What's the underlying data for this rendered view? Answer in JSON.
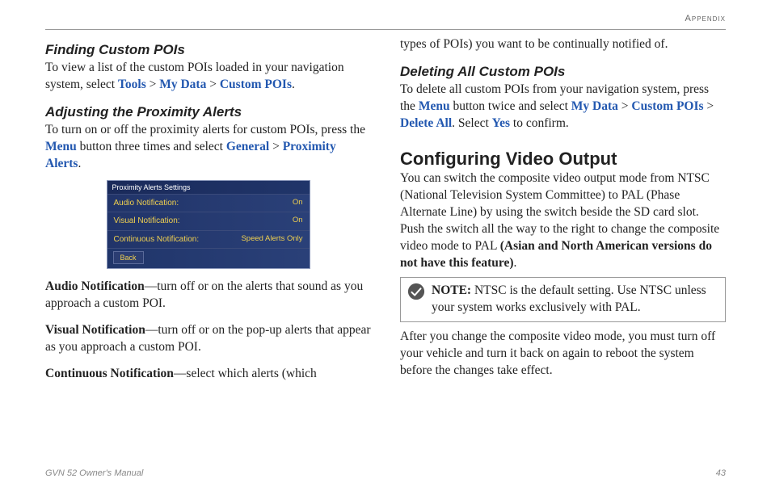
{
  "header": {
    "section": "Appendix"
  },
  "left": {
    "h1": "Finding Custom POIs",
    "p1a": "To view a list of the custom POIs loaded in your navigation system, select ",
    "l1": "Tools",
    "sep": " > ",
    "l2": "My Data",
    "l3": "Custom POIs",
    "p1b": ".",
    "h2": "Adjusting the Proximity Alerts",
    "p2a": "To turn on or off the proximity alerts for custom POIs, press the ",
    "l4": "Menu",
    "p2b": " button three times and select ",
    "l5": "General",
    "l6": "Proximity Alerts",
    "panel": {
      "title": "Proximity Alerts Settings",
      "rows": [
        {
          "label": "Audio Notification:",
          "value": "On"
        },
        {
          "label": "Visual Notification:",
          "value": "On"
        },
        {
          "label": "Continuous Notification:",
          "value": "Speed Alerts Only"
        }
      ],
      "back": "Back"
    },
    "d1_b": "Audio Notification",
    "d1_t": "—turn off or on the alerts that sound as you approach a custom POI.",
    "d2_b": "Visual Notification",
    "d2_t": "—turn off or on the pop-up alerts that appear as you approach a custom POI.",
    "d3_b": "Continuous Notification",
    "d3_t": "—select which alerts (which "
  },
  "right": {
    "cont": "types of POIs) you want to be continually notified of.",
    "h1": "Deleting All Custom POIs",
    "p1a": "To delete all custom POIs from your navigation system, press the ",
    "l1": "Menu",
    "p1b": " button twice and select ",
    "l2": "My Data",
    "l3": "Custom POIs",
    "l4": "Delete All",
    "p1c": ". Select ",
    "l5": "Yes",
    "p1d": " to confirm.",
    "h2": "Configuring Video Output",
    "p2a": "You can switch the composite video output mode from NTSC (National Television System Committee) to PAL (Phase Alternate Line) by using the switch beside the SD card slot. Push the switch all the way to the right to change the composite video mode to PAL ",
    "p2b": "(Asian and North American versions do not have this feature)",
    "p2c": ".",
    "note_b": "NOTE:",
    "note_t": " NTSC is the default setting. Use NTSC unless your system works exclusively with PAL.",
    "p3": "After you change the composite video mode, you must turn off your vehicle and turn it back on again to reboot the system before the changes take effect."
  },
  "footer": {
    "left": "GVN 52 Owner's Manual",
    "right": "43"
  }
}
